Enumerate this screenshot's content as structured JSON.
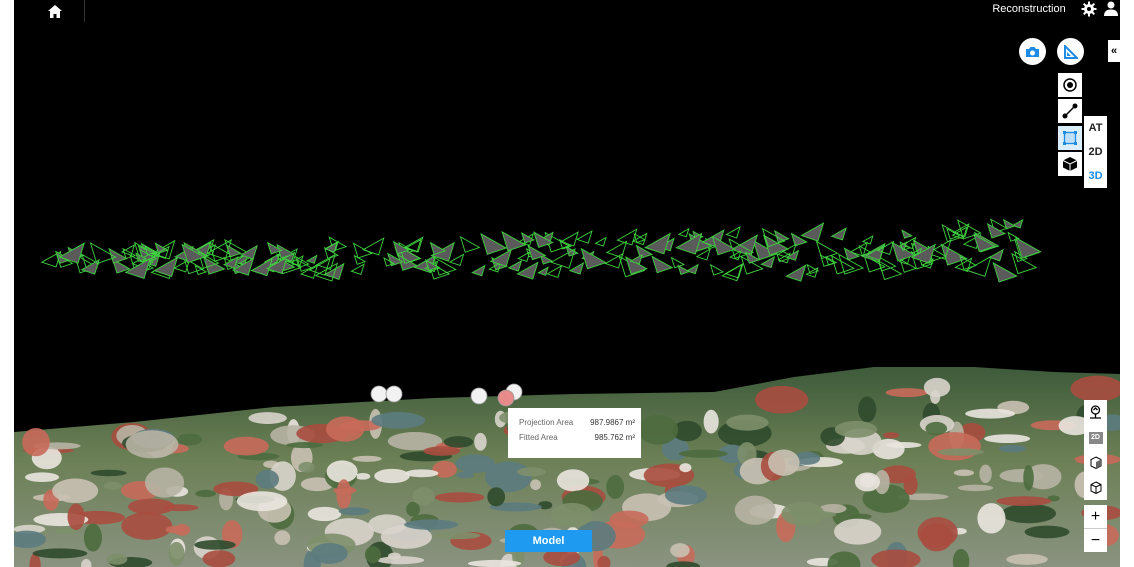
{
  "header": {
    "title": "Reconstruction"
  },
  "icons": {
    "home": "home-icon",
    "settings": "gear-icon",
    "user": "user-icon",
    "camera": "camera-icon",
    "measure": "measure-icon",
    "point": "point-icon",
    "line": "polyline-icon",
    "area": "area-icon",
    "volume": "volume-icon",
    "terrain": "terrain-icon",
    "view2d": "2d-view-icon",
    "box1": "box-icon",
    "box2": "cube-icon"
  },
  "collapse_label": "«",
  "modes": [
    "AT",
    "2D",
    "3D"
  ],
  "active_mode": "3D",
  "right_tools": {
    "view2d_label": "2D"
  },
  "zoom": {
    "in": "+",
    "out": "−"
  },
  "measurement": {
    "projection_label": "Projection Area",
    "projection_value": "987.9867 m²",
    "fitted_label": "Fitted Area",
    "fitted_value": "985.762 m²"
  },
  "model_button": "Model",
  "colors": {
    "accent": "#1e9bf0",
    "camera_frustum": "#3fd23f"
  }
}
